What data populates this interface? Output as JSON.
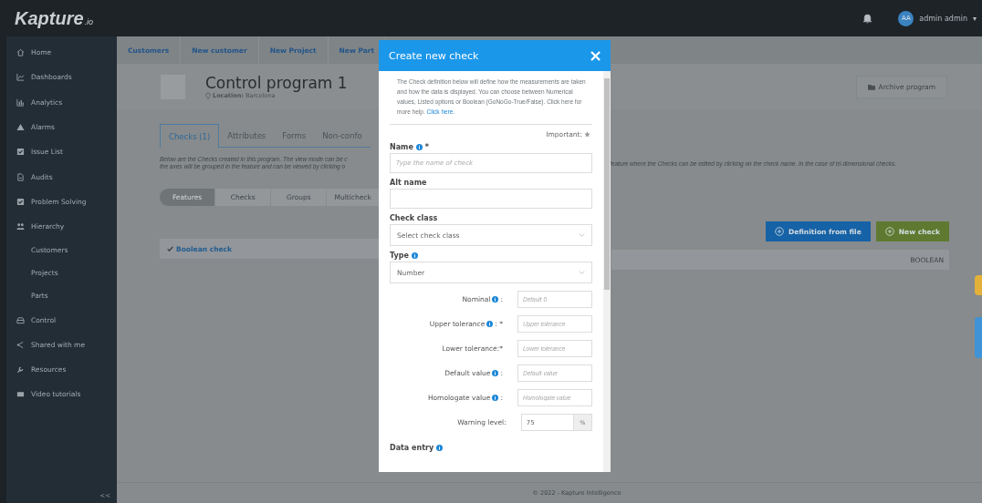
{
  "topbar": {
    "logo": "Kapture",
    "logo_suffix": ".io",
    "avatar": "AA",
    "user": "admin admin",
    "caret": "▾"
  },
  "sidebar": {
    "items": [
      {
        "label": "Home",
        "selected": false
      },
      {
        "label": "Dashboards",
        "selected": false
      },
      {
        "label": "Analytics",
        "selected": false
      },
      {
        "label": "Alarms",
        "selected": false
      },
      {
        "label": "Issue List",
        "selected": false
      },
      {
        "label": "Audits",
        "selected": false
      },
      {
        "label": "Problem Solving",
        "selected": false
      },
      {
        "label": "Hierarchy",
        "selected": false,
        "children": [
          {
            "label": "Customers",
            "selected": false
          },
          {
            "label": "Projects",
            "selected": false
          },
          {
            "label": "Parts",
            "selected": false
          }
        ]
      },
      {
        "label": "Control",
        "selected": false
      },
      {
        "label": "Shared with me",
        "selected": false
      },
      {
        "label": "Resources",
        "selected": false
      },
      {
        "label": "Video tutorials",
        "selected": false
      }
    ],
    "collapse": "<<"
  },
  "breadcrumbs": [
    "Customers",
    "New customer",
    "New Project",
    "New Part"
  ],
  "program": {
    "title": "Control program 1",
    "location": "**Location:** Barcelona",
    "archive_button": "Archive program"
  },
  "tabs": [
    {
      "label": "Checks (1)",
      "selected": true
    },
    {
      "label": "Attributes",
      "selected": false
    },
    {
      "label": "Forms",
      "selected": false
    },
    {
      "label": "Non-confo",
      "selected": false
    }
  ],
  "description": {
    "left_lines": [
      "Below are the Checks created in this program. The view mode can be c",
      "the axes will be grouped in the feature and can be viewed by clicking o"
    ],
    "right": "feature where the Checks can be edited by clicking on the check name. In the case of tri-dimensional checks."
  },
  "view_modes": [
    {
      "label": "Features",
      "selected": true
    },
    {
      "label": "Checks",
      "selected": false
    },
    {
      "label": "Groups",
      "selected": false
    },
    {
      "label": "Multicheck",
      "selected": false
    }
  ],
  "actions": [
    {
      "label": "Definition from file",
      "kind": "primary"
    },
    {
      "label": "New check",
      "kind": "success"
    }
  ],
  "checks": [
    {
      "name": "Boolean check",
      "type": "BOOLEAN"
    }
  ],
  "footer": "© 2022 - Kapture Intelligence",
  "modal": {
    "title": "Create new check",
    "close": "×",
    "intro": "The Check definition below will define how the measurements are taken and how the data is displayed. You can choose between Numerical values, Listed options or Boolean (GoNoGo-True/False). Click here for more help.",
    "intro_link": "Click here.",
    "important": "Important:",
    "fields": [
      {
        "kind": "input",
        "label": "Name",
        "info": true,
        "suffix": "*",
        "placeholder": "Type the name of check"
      },
      {
        "kind": "input",
        "label": "Alt name",
        "info": false
      },
      {
        "kind": "select",
        "label": "Check class",
        "info": false,
        "value": "Select check class"
      },
      {
        "kind": "select",
        "label": "Type",
        "info": true,
        "value": "Number"
      }
    ],
    "rows": [
      {
        "kind": "input",
        "label": "Nominal",
        "info": true,
        "suffix": ":",
        "placeholder": "Default 0"
      },
      {
        "kind": "input",
        "label": "Upper tolerance",
        "info": true,
        "suffix": ": *",
        "placeholder": "Upper tolerance"
      },
      {
        "kind": "input",
        "label": "Lower tolerance:*",
        "info": false,
        "placeholder": "Lower tolerance"
      },
      {
        "kind": "input",
        "label": "Default value",
        "info": true,
        "suffix": ":",
        "placeholder": "Default value"
      },
      {
        "kind": "input",
        "label": "Homologate value",
        "info": true,
        "suffix": ":",
        "placeholder": "Homologate value"
      },
      {
        "kind": "addon",
        "label": "Warning level:",
        "info": false,
        "value": "75",
        "addon": "%"
      }
    ],
    "next_label": "Data entry"
  }
}
